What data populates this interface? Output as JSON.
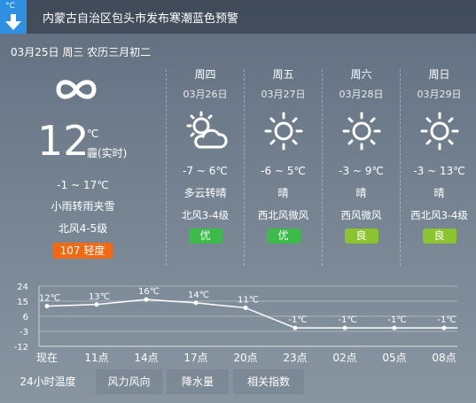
{
  "alert": {
    "icon_unit": "°C",
    "text": "内蒙古自治区包头市发布寒潮蓝色预警"
  },
  "today": {
    "date_line": "03月25日 周三 农历三月初二",
    "icon": "haze-infinity-icon",
    "temp": "12",
    "unit": "℃",
    "condition": "霾(实时)",
    "range": "-1 ~ 17℃",
    "desc": "小雨转雨夹雪",
    "wind": "北风4-5级",
    "aqi": "107  轻度",
    "aqi_color": "#f06a16"
  },
  "forecast": [
    {
      "day": "周四",
      "date": "03月26日",
      "icon": "partly-cloudy-icon",
      "range": "-7 ~ 6℃",
      "weather": "多云转晴",
      "wind": "北风3-4级",
      "aqi": "优"
    },
    {
      "day": "周五",
      "date": "03月27日",
      "icon": "sunny-icon",
      "range": "-6 ~ 5℃",
      "weather": "晴",
      "wind": "西北风微风",
      "aqi": "优"
    },
    {
      "day": "周六",
      "date": "03月28日",
      "icon": "sunny-icon",
      "range": "-3 ~ 9℃",
      "weather": "晴",
      "wind": "西风微风",
      "aqi": "良"
    },
    {
      "day": "周日",
      "date": "03月29日",
      "icon": "sunny-icon",
      "range": "-3 ~ 13℃",
      "weather": "晴",
      "wind": "西北风3-4级",
      "aqi": "良"
    }
  ],
  "chart_data": {
    "type": "line",
    "categories": [
      "现在",
      "11点",
      "14点",
      "17点",
      "20点",
      "23点",
      "02点",
      "05点",
      "08点"
    ],
    "series": [
      {
        "values": [
          12,
          13,
          16,
          14,
          11,
          -1,
          -1,
          -1,
          -1
        ]
      }
    ],
    "point_labels": [
      "12℃",
      "13℃",
      "16℃",
      "14℃",
      "11℃",
      "-1℃",
      "-1℃",
      "-1℃",
      "-1℃"
    ],
    "yticks": [
      "24",
      "15",
      "6",
      "-3",
      "-12"
    ],
    "ylim": [
      -12,
      24
    ],
    "grid": true
  },
  "tabs": [
    "24小时温度",
    "风力风向",
    "降水量",
    "相关指数"
  ],
  "colors": {
    "good": "#3cba4a",
    "moderate": "#8bc430",
    "alert_blue": "#2f8fe0"
  }
}
